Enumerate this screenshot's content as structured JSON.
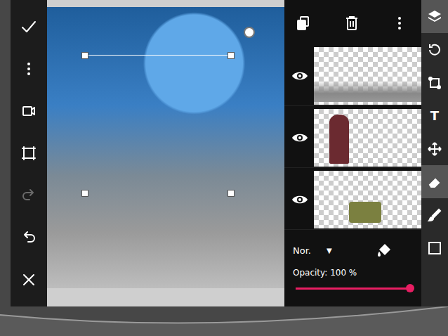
{
  "left_toolbar": [
    {
      "kind": "check",
      "disabled": false
    },
    {
      "kind": "more",
      "disabled": false
    },
    {
      "kind": "video",
      "disabled": false
    },
    {
      "kind": "crop",
      "disabled": false
    },
    {
      "kind": "redo",
      "disabled": true
    },
    {
      "kind": "undo",
      "disabled": false
    },
    {
      "kind": "close",
      "disabled": false
    }
  ],
  "layers_toolbar": [
    {
      "kind": "duplicate"
    },
    {
      "kind": "trash"
    },
    {
      "kind": "more"
    }
  ],
  "layers": [
    {
      "visible": true,
      "kind": "clouds"
    },
    {
      "visible": true,
      "kind": "figure"
    },
    {
      "visible": true,
      "kind": "pipe"
    }
  ],
  "blend": {
    "mode": "Nor.",
    "arrow": "▼"
  },
  "opacity": {
    "label": "Opacity: 100 %",
    "level": 1
  },
  "tools": [
    {
      "kind": "layers",
      "selected": true,
      "glyph": ""
    },
    {
      "kind": "rotate",
      "selected": false,
      "glyph": ""
    },
    {
      "kind": "transform",
      "selected": false,
      "glyph": ""
    },
    {
      "kind": "text",
      "selected": false,
      "glyph": "T"
    },
    {
      "kind": "move",
      "selected": false,
      "glyph": ""
    },
    {
      "kind": "eraser",
      "selected": true,
      "glyph": ""
    },
    {
      "kind": "brush",
      "selected": false,
      "glyph": ""
    },
    {
      "kind": "color",
      "selected": false,
      "glyph": ""
    }
  ]
}
